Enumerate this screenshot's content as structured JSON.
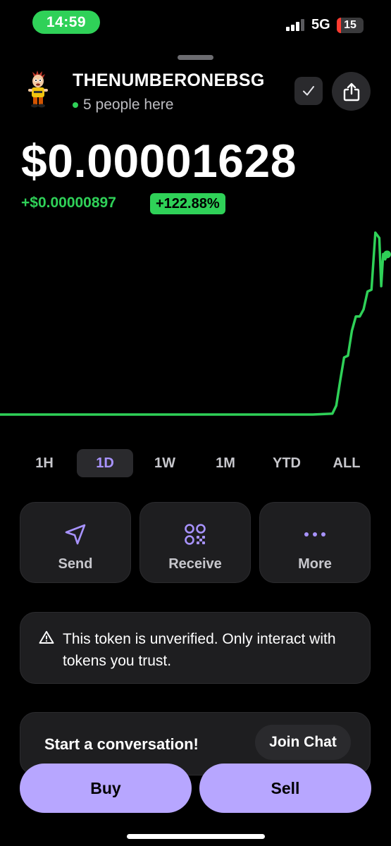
{
  "status_bar": {
    "time": "14:59",
    "network": "5G",
    "battery": "15",
    "battery_level": 0.15,
    "time_color": "#2fd158",
    "battery_color": "#ff3b30"
  },
  "header": {
    "token_name": "THENUMBERONEBSG",
    "presence": "5 people here",
    "avatar_icon": "cartoon-mascot-icon",
    "verify_icon": "checkmark-icon",
    "share_icon": "share-icon"
  },
  "price": {
    "value": "$0.00001628",
    "change_abs": "+$0.00000897",
    "change_pct": "+122.88%",
    "positive_color": "#2fd158"
  },
  "chart_data": {
    "type": "line",
    "x": [
      0,
      10,
      20,
      30,
      40,
      50,
      55,
      60,
      65,
      70,
      75,
      80,
      85,
      86,
      87,
      88,
      89,
      90,
      91,
      92,
      93,
      94,
      95,
      96,
      97,
      97.5,
      98,
      98.5,
      99
    ],
    "values": [
      7.3,
      7.3,
      7.3,
      7.3,
      7.3,
      7.3,
      7.3,
      7.3,
      7.3,
      7.3,
      7.3,
      7.3,
      7.35,
      7.8,
      9.2,
      10.5,
      10.6,
      12.0,
      12.8,
      12.8,
      13.2,
      14.2,
      14.3,
      17.5,
      17.2,
      14.5,
      16.3,
      16.0,
      16.28
    ],
    "line_color": "#2fd158",
    "title": "",
    "xlabel": "",
    "ylabel": "",
    "grid": false
  },
  "range_tabs": [
    {
      "label": "1H",
      "active": false
    },
    {
      "label": "1D",
      "active": true
    },
    {
      "label": "1W",
      "active": false
    },
    {
      "label": "1M",
      "active": false
    },
    {
      "label": "YTD",
      "active": false
    },
    {
      "label": "ALL",
      "active": false
    }
  ],
  "actions": {
    "send": {
      "label": "Send",
      "icon": "send-arrow-icon"
    },
    "receive": {
      "label": "Receive",
      "icon": "qr-code-icon"
    },
    "more": {
      "label": "More",
      "icon": "more-dots-icon"
    },
    "icon_color": "#a893ff"
  },
  "warning": {
    "text": "This token is unverified. Only interact with tokens you trust.",
    "icon": "warning-triangle-icon"
  },
  "chat": {
    "title": "Start a conversation!",
    "join_label": "Join Chat"
  },
  "trade": {
    "buy_label": "Buy",
    "sell_label": "Sell",
    "button_color": "#b7a6ff"
  }
}
